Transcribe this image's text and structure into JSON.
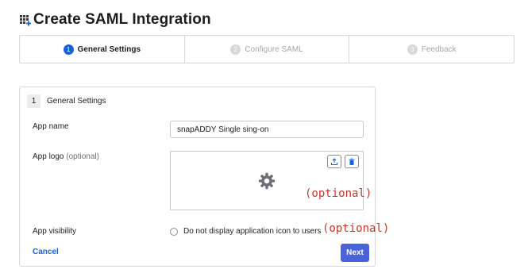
{
  "page": {
    "title": "Create SAML Integration"
  },
  "stepper": {
    "steps": [
      {
        "number": "1",
        "label": "General Settings",
        "active": true
      },
      {
        "number": "2",
        "label": "Configure SAML",
        "active": false
      },
      {
        "number": "3",
        "label": "Feedback",
        "active": false
      }
    ]
  },
  "form": {
    "section_number": "1",
    "section_title": "General Settings",
    "app_name": {
      "label": "App name",
      "value": "snapADDY Single sing-on"
    },
    "app_logo": {
      "label": "App logo",
      "optional": "(optional)",
      "annotation": "(optional)"
    },
    "app_visibility": {
      "label": "App visibility",
      "checkbox_label": "Do not display application icon to users",
      "annotation": "(optional)",
      "checked": false
    },
    "cancel_label": "Cancel",
    "next_label": "Next"
  },
  "colors": {
    "accent": "#1662dd",
    "button": "#4a63d8",
    "annotation": "#c0392b"
  },
  "icons": {
    "header": "app-grid-icon",
    "upload": "upload-icon",
    "delete": "trash-icon",
    "logo_placeholder": "gear-icon"
  }
}
